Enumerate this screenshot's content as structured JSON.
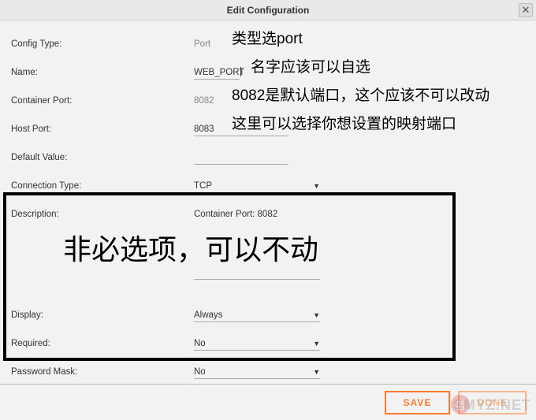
{
  "window": {
    "title": "Edit Configuration",
    "close_glyph": "✕"
  },
  "fields": {
    "config_type": {
      "label": "Config Type:",
      "value": "Port"
    },
    "name": {
      "label": "Name:",
      "value": "WEB_PORT"
    },
    "container_port": {
      "label": "Container Port:",
      "value": "8082"
    },
    "host_port": {
      "label": "Host Port:",
      "value": "8083"
    },
    "default_value": {
      "label": "Default Value:",
      "value": ""
    },
    "connection_type": {
      "label": "Connection Type:",
      "value": "TCP"
    },
    "description": {
      "label": "Description:",
      "value": "Container Port: 8082"
    },
    "display": {
      "label": "Display:",
      "value": "Always"
    },
    "required": {
      "label": "Required:",
      "value": "No"
    },
    "password_mask": {
      "label": "Password Mask:",
      "value": "No"
    }
  },
  "annotations": {
    "config_type": "类型选port",
    "name": "名字应该可以自选",
    "container_port": "8082是默认端口，这个应该不可以改动",
    "host_port": "这里可以选择你想设置的映射端口",
    "optional_box": "非必选项，可以不动"
  },
  "footer": {
    "save": "Save",
    "done": "Done"
  },
  "watermark": "SMYZ.NET",
  "wm_badge": "值"
}
